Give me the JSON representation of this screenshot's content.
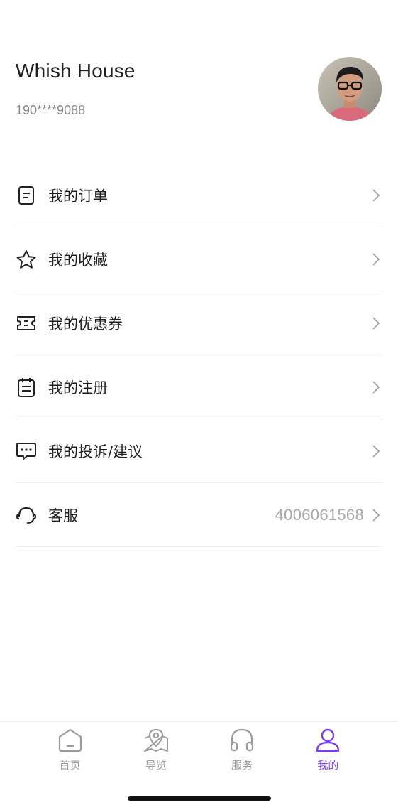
{
  "profile": {
    "name": "Whish House",
    "phone": "190****9088",
    "avatar_icon": "user-avatar-photo"
  },
  "menu": {
    "items": [
      {
        "label": "我的订单",
        "icon": "order-document-icon",
        "value": ""
      },
      {
        "label": "我的收藏",
        "icon": "star-icon",
        "value": ""
      },
      {
        "label": "我的优惠券",
        "icon": "coupon-icon",
        "value": ""
      },
      {
        "label": "我的注册",
        "icon": "registration-clipboard-icon",
        "value": ""
      },
      {
        "label": "我的投诉/建议",
        "icon": "chat-bubble-icon",
        "value": ""
      },
      {
        "label": "客服",
        "icon": "headset-icon",
        "value": "4006061568"
      }
    ]
  },
  "tabbar": {
    "tabs": [
      {
        "label": "首页",
        "icon": "home-icon",
        "active": false
      },
      {
        "label": "导览",
        "icon": "map-pin-icon",
        "active": false
      },
      {
        "label": "服务",
        "icon": "headphones-icon",
        "active": false
      },
      {
        "label": "我的",
        "icon": "user-icon",
        "active": true
      }
    ],
    "active_color": "#7a3df0",
    "inactive_color": "#9b9b9b"
  }
}
